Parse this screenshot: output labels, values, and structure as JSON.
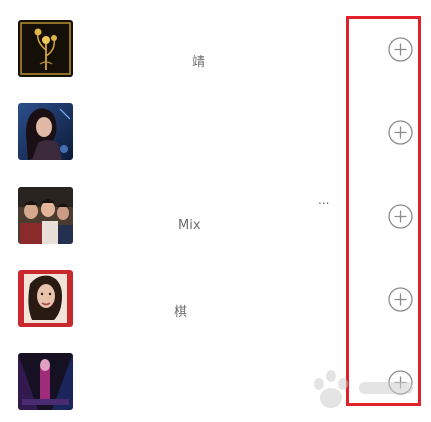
{
  "colors": {
    "highlight_box": "#e0202a",
    "add_icon": "#8c8c8c",
    "faded_text": "#e6e6e6",
    "visible_text": "#6e6e6e"
  },
  "songs": [
    {
      "title": "",
      "artist": "",
      "artist_tail": "靖",
      "title_ellipsis": "",
      "cover_icon": "album-cover-golden-flower",
      "add_icon": "circle-plus-icon"
    },
    {
      "title": "",
      "artist": "",
      "artist_tail": "",
      "title_ellipsis": "",
      "cover_icon": "album-cover-woman-blue",
      "add_icon": "circle-plus-icon"
    },
    {
      "title": "",
      "artist": "",
      "artist_tail": "Mix",
      "title_ellipsis": "...",
      "cover_icon": "album-cover-group-photo",
      "add_icon": "circle-plus-icon"
    },
    {
      "title": "",
      "artist": "",
      "artist_tail": "棋",
      "title_ellipsis": "",
      "cover_icon": "album-cover-woman-red",
      "add_icon": "circle-plus-icon"
    },
    {
      "title": "",
      "artist": "",
      "artist_tail": "",
      "title_ellipsis": "",
      "cover_icon": "album-cover-stage-purple",
      "add_icon": "circle-plus-icon"
    }
  ]
}
